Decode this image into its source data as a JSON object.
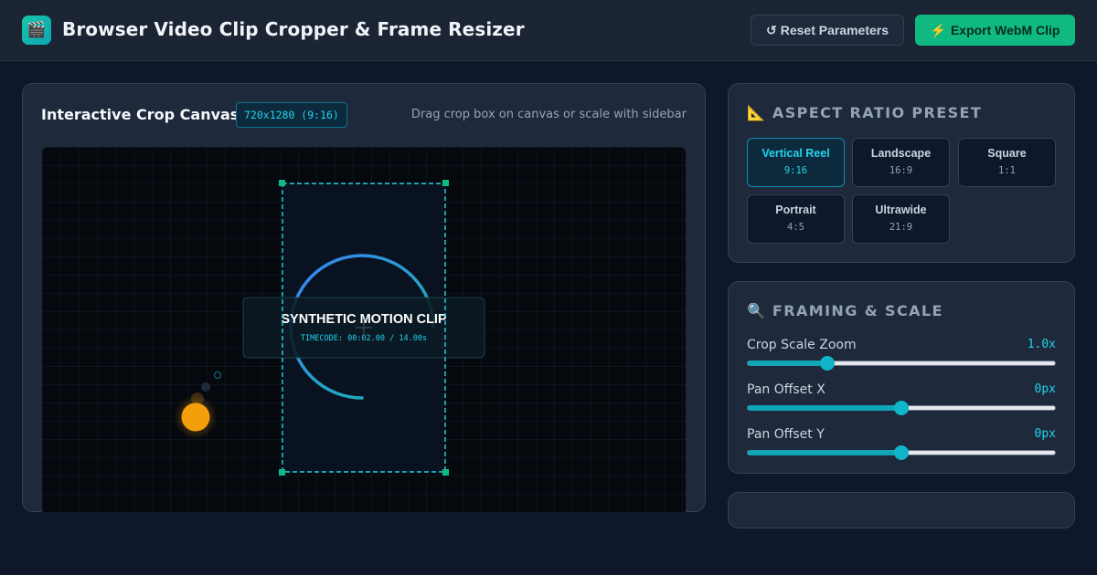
{
  "header": {
    "logo_icon": "clapper-board-icon",
    "title": "Browser Video Clip Cropper & Frame Resizer",
    "reset_icon": "↺",
    "reset_label": "Reset Parameters",
    "export_icon": "⚡",
    "export_label": "Export WebM Clip"
  },
  "canvas": {
    "title": "Interactive Crop Canvas",
    "dimensions": "720x1280 (9:16)",
    "hint": "Drag crop box on canvas or scale with sidebar",
    "clip_title": "SYNTHETIC MOTION CLIP",
    "timecode": "TIMECODE: 00:02.00 / 14.00s"
  },
  "aspect": {
    "icon": "📐",
    "title": "ASPECT RATIO PRESET",
    "presets": [
      {
        "label": "Vertical Reel",
        "ratio": "9:16",
        "active": true
      },
      {
        "label": "Landscape",
        "ratio": "16:9",
        "active": false
      },
      {
        "label": "Square",
        "ratio": "1:1",
        "active": false
      },
      {
        "label": "Portrait",
        "ratio": "4:5",
        "active": false
      },
      {
        "label": "Ultrawide",
        "ratio": "21:9",
        "active": false
      }
    ]
  },
  "framing": {
    "icon": "🔍",
    "title": "FRAMING & SCALE",
    "sliders": [
      {
        "label": "Crop Scale Zoom",
        "value": "1.0x",
        "level": 0.26
      },
      {
        "label": "Pan Offset X",
        "value": "0px",
        "level": 0.5
      },
      {
        "label": "Pan Offset Y",
        "value": "0px",
        "level": 0.5
      }
    ]
  },
  "colors": {
    "accent": "#22d3ee",
    "success": "#10b981",
    "background": "#0f172a",
    "panel": "#1e293b"
  }
}
